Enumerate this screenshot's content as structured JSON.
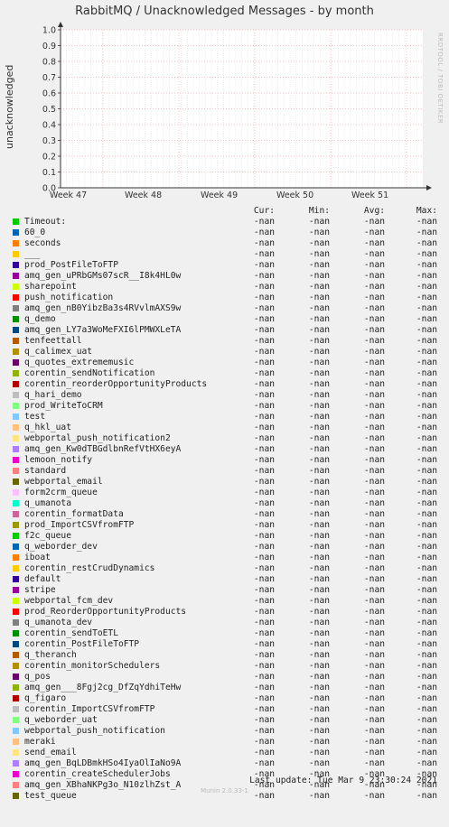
{
  "title": "RabbitMQ / Unacknowledged Messages - by month",
  "side_note": "RRDTOOL / TOBI OETIKER",
  "chart_data": {
    "type": "line",
    "ylabel": "unacknowledged",
    "ylim": [
      0.0,
      1.0
    ],
    "ytick_labels": [
      "0.0",
      "0.1",
      "0.2",
      "0.3",
      "0.4",
      "0.5",
      "0.6",
      "0.7",
      "0.8",
      "0.9",
      "1.0"
    ],
    "xtick_labels": [
      "Week 47",
      "Week 48",
      "Week 49",
      "Week 50",
      "Week 51"
    ],
    "grid": true,
    "series_values": "-nan"
  },
  "legend": {
    "headers": [
      "Cur:",
      "Min:",
      "Avg:",
      "Max:"
    ],
    "nan_value": "-nan",
    "items": [
      {
        "name": "Timeout:",
        "color": "#00cc00"
      },
      {
        "name": "60_0",
        "color": "#0066b3"
      },
      {
        "name": "seconds",
        "color": "#ff8000"
      },
      {
        "name": "___",
        "color": "#ffcc00"
      },
      {
        "name": "prod_PostFileToFTP",
        "color": "#330099"
      },
      {
        "name": "amq_gen_uPRbGMs07scR__I8k4HL0w",
        "color": "#990099"
      },
      {
        "name": "sharepoint",
        "color": "#ccff00"
      },
      {
        "name": "push_notification",
        "color": "#ff0000"
      },
      {
        "name": "amq_gen_nB0YibzBa3s4RVvlmAXS9w",
        "color": "#808080"
      },
      {
        "name": "q_demo",
        "color": "#008f00"
      },
      {
        "name": "amq_gen_LY7a3WoMeFXI6lPMWXLeTA",
        "color": "#00487d"
      },
      {
        "name": "tenfeettall",
        "color": "#b35a00"
      },
      {
        "name": "q_calimex_uat",
        "color": "#b38f00"
      },
      {
        "name": "q_quotes_extrememusic",
        "color": "#6b006b"
      },
      {
        "name": "corentin_sendNotification",
        "color": "#8fb300"
      },
      {
        "name": "corentin_reorderOpportunityProducts",
        "color": "#b30000"
      },
      {
        "name": "q_hari_demo",
        "color": "#bebebe"
      },
      {
        "name": "prod_WriteToCRM",
        "color": "#80ff80"
      },
      {
        "name": "test",
        "color": "#80c9ff"
      },
      {
        "name": "q_hkl_uat",
        "color": "#ffc080"
      },
      {
        "name": "webportal_push_notification2",
        "color": "#ffe680"
      },
      {
        "name": "amq_gen_Kw0dTBGdlbnRefVtHX6eyA",
        "color": "#aa80ff"
      },
      {
        "name": "lemoon_notify",
        "color": "#ee00cc"
      },
      {
        "name": "standard",
        "color": "#ff8080"
      },
      {
        "name": "webportal_email",
        "color": "#666600"
      },
      {
        "name": "form2crm_queue",
        "color": "#ffbfff"
      },
      {
        "name": "q_umanota",
        "color": "#00ffcc"
      },
      {
        "name": "corentin_formatData",
        "color": "#cc6699"
      },
      {
        "name": "prod_ImportCSVfromFTP",
        "color": "#999900"
      },
      {
        "name": "f2c_queue",
        "color": "#00cc00"
      },
      {
        "name": "q_weborder_dev",
        "color": "#0066b3"
      },
      {
        "name": "iboat",
        "color": "#ff8000"
      },
      {
        "name": "corentin_restCrudDynamics",
        "color": "#ffcc00"
      },
      {
        "name": "default",
        "color": "#330099"
      },
      {
        "name": "stripe",
        "color": "#990099"
      },
      {
        "name": "webportal_fcm_dev",
        "color": "#ccff00"
      },
      {
        "name": "prod_ReorderOpportunityProducts",
        "color": "#ff0000"
      },
      {
        "name": "q_umanota_dev",
        "color": "#808080"
      },
      {
        "name": "corentin_sendToETL",
        "color": "#008f00"
      },
      {
        "name": "corentin_PostFileToFTP",
        "color": "#00487d"
      },
      {
        "name": "q_theranch",
        "color": "#b35a00"
      },
      {
        "name": "corentin_monitorSchedulers",
        "color": "#b38f00"
      },
      {
        "name": "q_pos",
        "color": "#6b006b"
      },
      {
        "name": "amq_gen___8Fgj2cg_DfZqYdhiTeHw",
        "color": "#8fb300"
      },
      {
        "name": "q_figaro",
        "color": "#b30000"
      },
      {
        "name": "corentin_ImportCSVfromFTP",
        "color": "#bebebe"
      },
      {
        "name": "q_weborder_uat",
        "color": "#80ff80"
      },
      {
        "name": "webportal_push_notification",
        "color": "#80c9ff"
      },
      {
        "name": "meraki",
        "color": "#ffc080"
      },
      {
        "name": "send_email",
        "color": "#ffe680"
      },
      {
        "name": "amq_gen_BqLDBmkHSo4IyaOlIaNo9A",
        "color": "#aa80ff"
      },
      {
        "name": "corentin_createSchedulerJobs",
        "color": "#ee00cc"
      },
      {
        "name": "amq_gen_XBhaNKPg3o_N10zlhZst_A",
        "color": "#ff8080"
      },
      {
        "name": "test_queue",
        "color": "#666600"
      }
    ]
  },
  "last_update": "Last update:  Tue Mar  9 23:30:24 2021",
  "munin_version": "Munin 2.0.33-1"
}
